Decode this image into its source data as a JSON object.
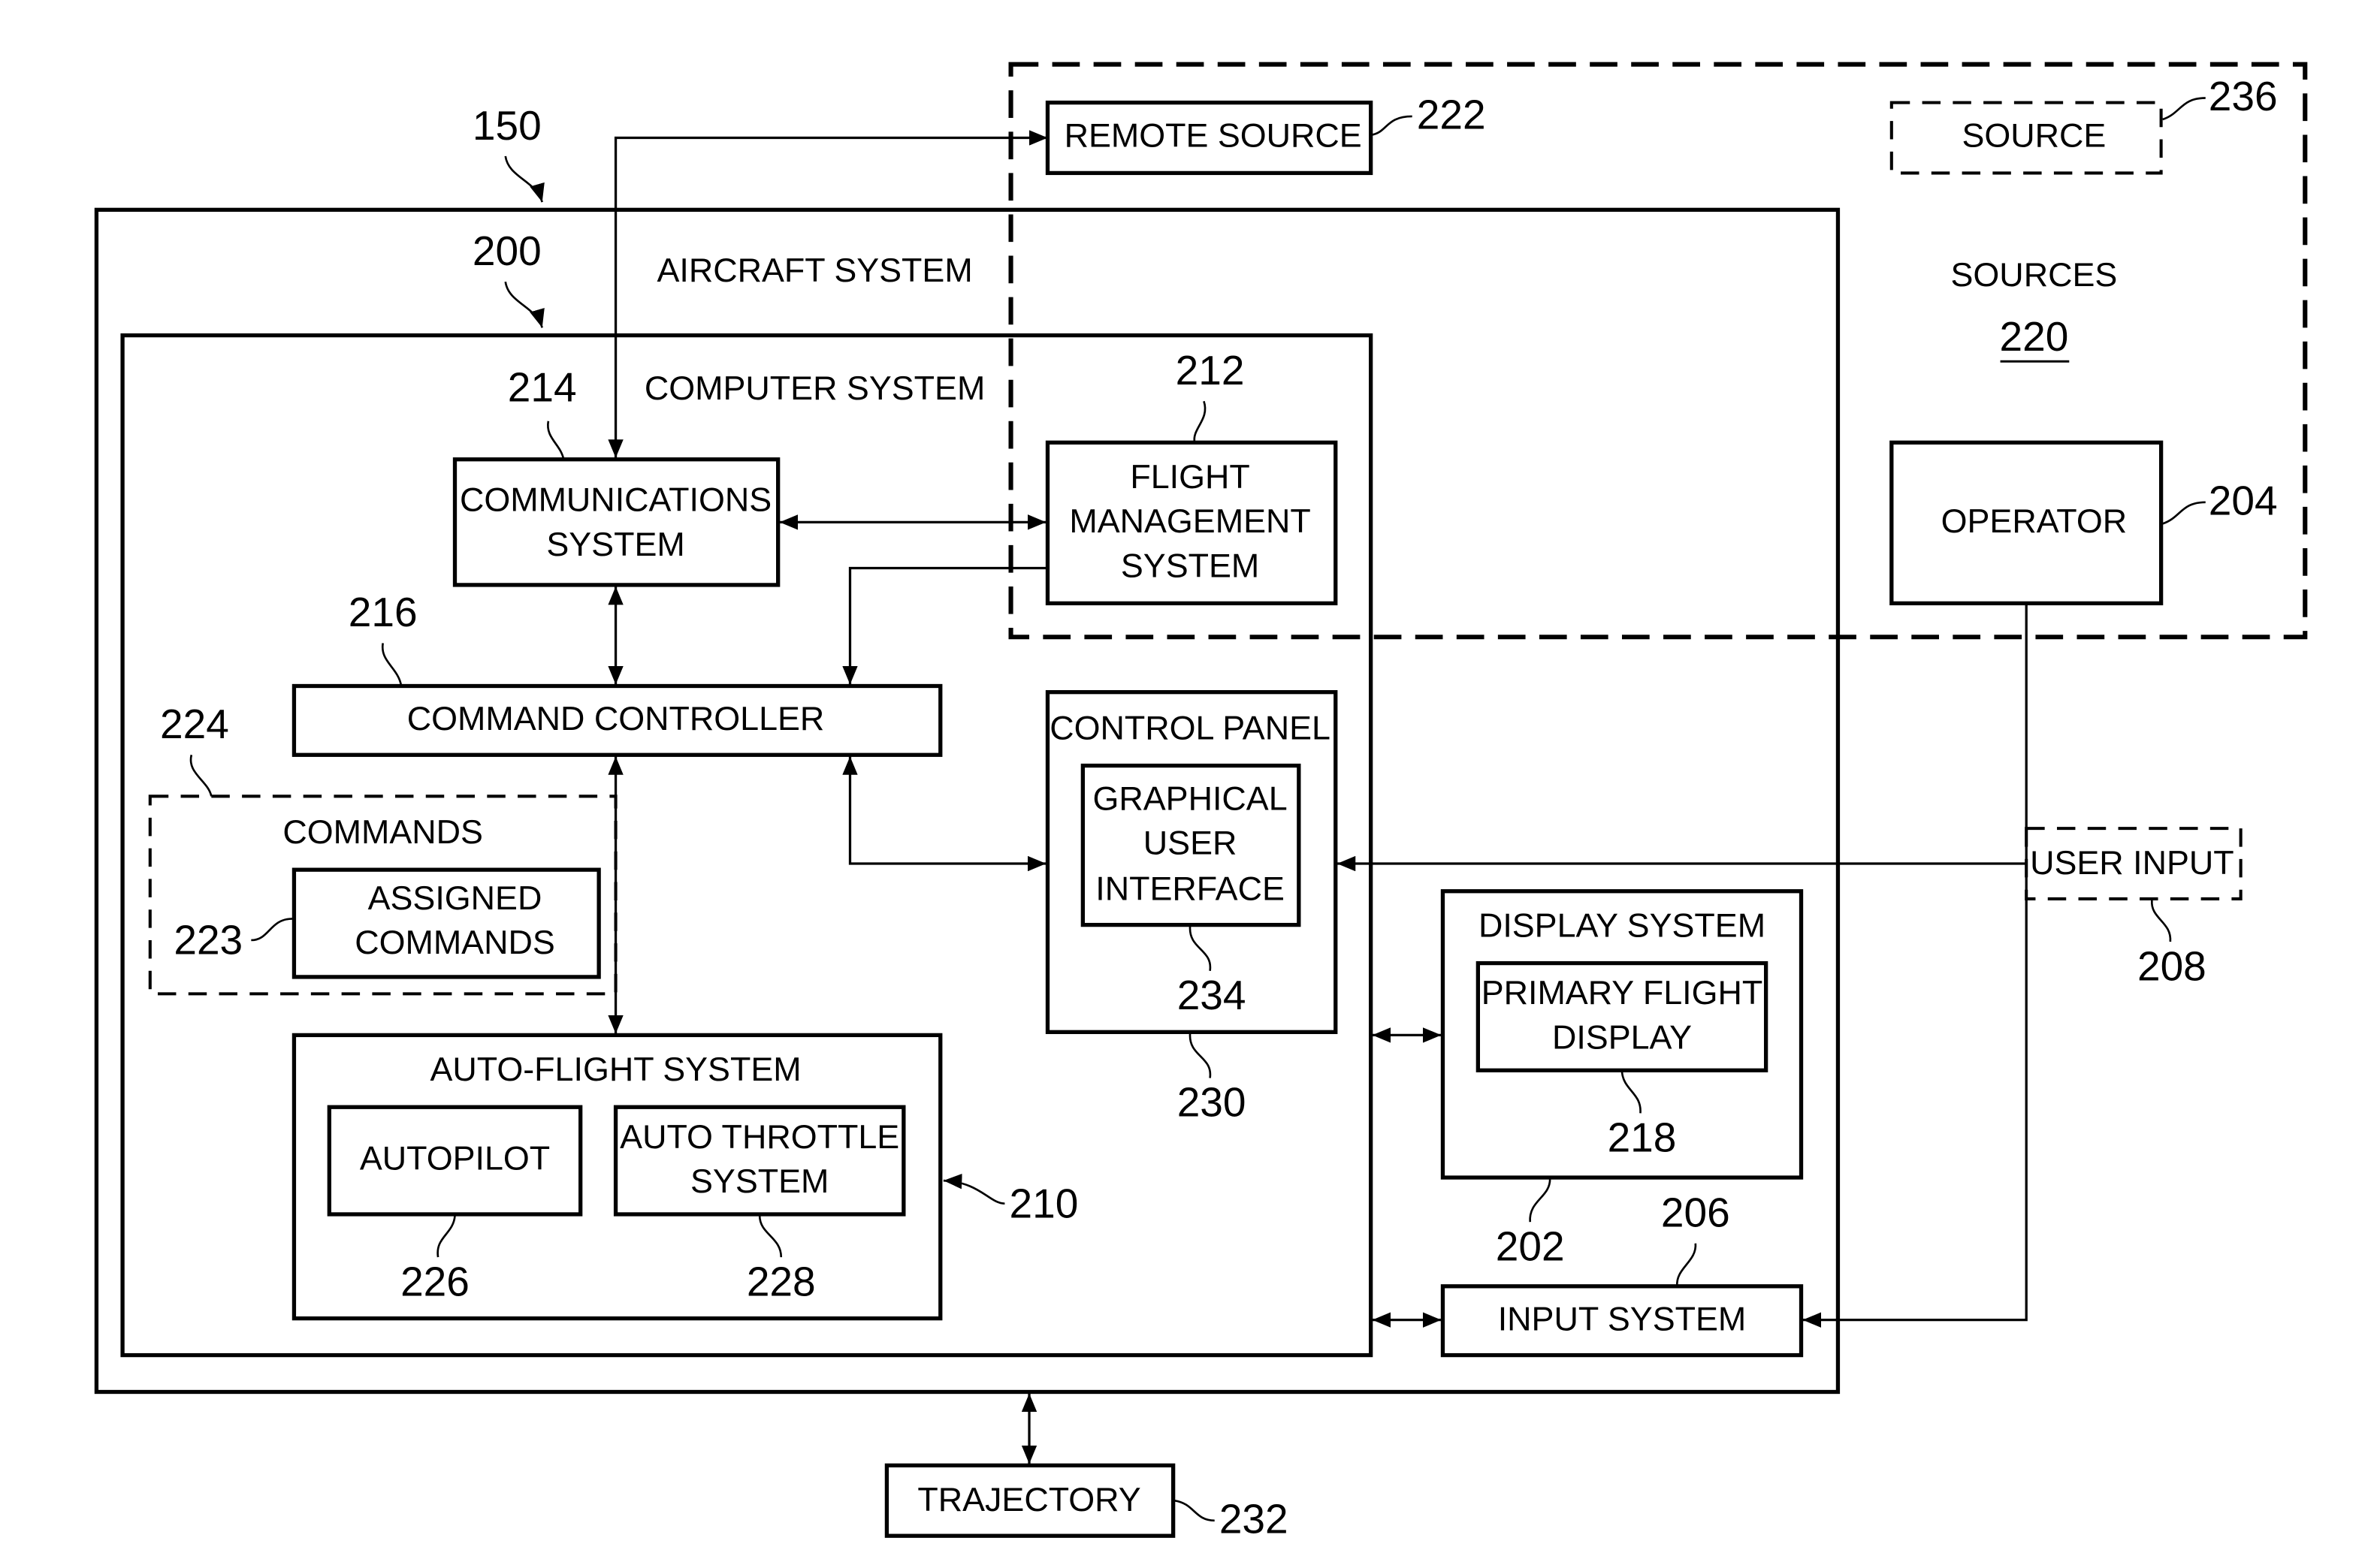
{
  "diagram": {
    "title_refs": {
      "outer": "150",
      "computer": "200"
    },
    "colors": {
      "ink": "#000000",
      "paper": "#ffffff"
    },
    "blocks": {
      "aircraft_system": {
        "label": "AIRCRAFT SYSTEM"
      },
      "computer_system": {
        "label": "COMPUTER SYSTEM"
      },
      "communications_system": {
        "line1": "COMMUNICATIONS",
        "line2": "SYSTEM",
        "ref": "214"
      },
      "flight_management_system": {
        "line1": "FLIGHT",
        "line2": "MANAGEMENT",
        "line3": "SYSTEM",
        "ref": "212"
      },
      "command_controller": {
        "label": "COMMAND CONTROLLER",
        "ref": "216"
      },
      "commands": {
        "label": "COMMANDS",
        "ref": "224"
      },
      "assigned_commands": {
        "line1": "ASSIGNED",
        "line2": "COMMANDS",
        "ref": "223"
      },
      "control_panel": {
        "label": "CONTROL PANEL",
        "ref": "230"
      },
      "graphical_user_interface": {
        "line1": "GRAPHICAL",
        "line2": "USER",
        "line3": "INTERFACE",
        "ref": "234"
      },
      "auto_flight_system": {
        "label": "AUTO-FLIGHT SYSTEM",
        "ref": "210"
      },
      "autopilot": {
        "label": "AUTOPILOT",
        "ref": "226"
      },
      "auto_throttle_system": {
        "line1": "AUTO THROTTLE",
        "line2": "SYSTEM",
        "ref": "228"
      },
      "display_system": {
        "label": "DISPLAY SYSTEM",
        "ref": "202"
      },
      "primary_flight_display": {
        "line1": "PRIMARY FLIGHT",
        "line2": "DISPLAY",
        "ref": "218"
      },
      "input_system": {
        "label": "INPUT SYSTEM",
        "ref": "206"
      },
      "remote_source": {
        "label": "REMOTE SOURCE",
        "ref": "222"
      },
      "source": {
        "label": "SOURCE",
        "ref": "236"
      },
      "sources": {
        "label": "SOURCES",
        "ref": "220"
      },
      "operator": {
        "label": "OPERATOR",
        "ref": "204"
      },
      "user_input": {
        "label": "USER INPUT",
        "ref": "208"
      },
      "trajectory": {
        "label": "TRAJECTORY",
        "ref": "232"
      }
    }
  }
}
